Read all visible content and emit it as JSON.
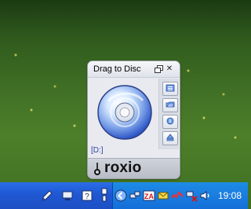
{
  "widget": {
    "title": "Drag to Disc",
    "drive_label": "[D:]",
    "brand": "roxio",
    "icons": {
      "restore": "restore-icon",
      "close": "close-icon",
      "disc": "disc-icon",
      "menu": "menu-icon",
      "open": "folder-open-icon",
      "info": "info-icon",
      "eject": "eject-icon",
      "logo": "roxio-logo-icon"
    }
  },
  "taskbar": {
    "clock": "19:08",
    "quicklaunch_icons": [
      "pen-icon",
      "monitor-icon",
      "help-icon",
      "usb-icon"
    ],
    "tray_icons": [
      "arrow-left-icon",
      "network-icon",
      "zonealarm-icon",
      "envelope-icon",
      "activity-icon",
      "network-warning-icon",
      "speaker-icon"
    ]
  }
}
